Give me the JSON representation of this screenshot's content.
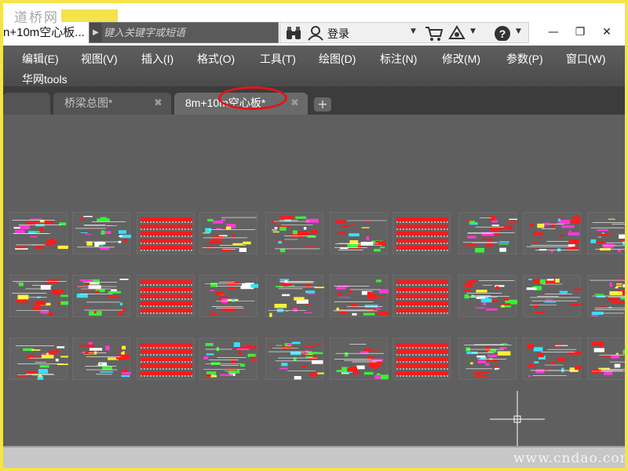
{
  "watermark": {
    "logo_text": "道桥网"
  },
  "window": {
    "doc_title": "n+10m空心板..."
  },
  "search": {
    "placeholder": "键入关键字或短语"
  },
  "toolbar": {
    "login_label": "登录"
  },
  "menu": {
    "items": [
      {
        "label": "编辑(E)"
      },
      {
        "label": "视图(V)"
      },
      {
        "label": "插入(I)"
      },
      {
        "label": "格式(O)"
      },
      {
        "label": "工具(T)"
      },
      {
        "label": "绘图(D)"
      },
      {
        "label": "标注(N)"
      },
      {
        "label": "修改(M)"
      },
      {
        "label": "参数(P)"
      },
      {
        "label": "窗口(W)"
      }
    ],
    "second_row": {
      "label": "华网tools"
    }
  },
  "tabs": [
    {
      "label": "",
      "active": false
    },
    {
      "label": "桥梁总图*",
      "active": false
    },
    {
      "label": "8m+10m空心板*",
      "active": true
    }
  ],
  "drawing_grid": {
    "rows": 3,
    "cols": 10
  },
  "colors": {
    "frame": "#f4e34a",
    "annotation": "#e3141b",
    "drawing_red": "#ff1a1a"
  },
  "status": {
    "site_mark": "www.cndao.com"
  }
}
